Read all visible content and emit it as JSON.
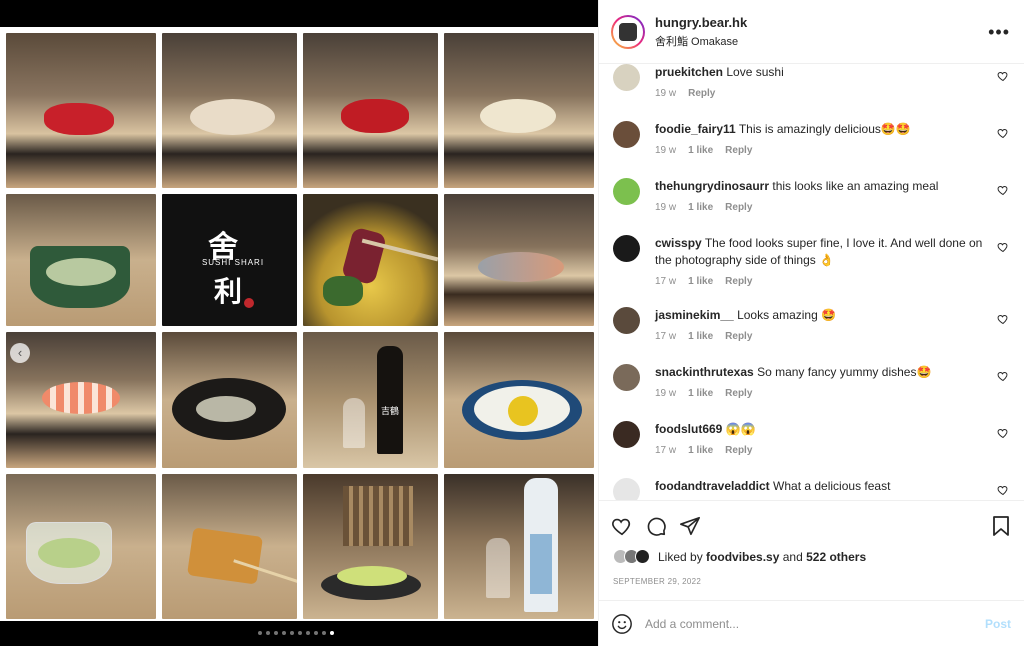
{
  "header": {
    "username": "hungry.bear.hk",
    "location": "舍利鮨 Omakase",
    "more_icon": "more-horizontal-icon"
  },
  "carousel": {
    "dot_count": 10,
    "active_dot": 9,
    "tile_logo_brand": "SUSHI SHARI",
    "bottle_label": "吉鶴"
  },
  "comments": [
    {
      "user": "pruekitchen",
      "text": "Love sushi",
      "age": "19 w",
      "likes": "",
      "reply": "Reply"
    },
    {
      "user": "foodie_fairy11",
      "text": "This is amazingly delicious🤩🤩",
      "age": "19 w",
      "likes": "1 like",
      "reply": "Reply"
    },
    {
      "user": "thehungrydinosaurr",
      "text": "this looks like an amazing meal",
      "age": "19 w",
      "likes": "1 like",
      "reply": "Reply"
    },
    {
      "user": "cwisspy",
      "text": "The food looks super fine, I love it. And well done on the photography side of things 👌",
      "age": "17 w",
      "likes": "1 like",
      "reply": "Reply"
    },
    {
      "user": "jasminekim__",
      "text": "Looks amazing 🤩",
      "age": "17 w",
      "likes": "1 like",
      "reply": "Reply"
    },
    {
      "user": "snackinthrutexas",
      "text": "So many fancy yummy dishes🤩",
      "age": "19 w",
      "likes": "1 like",
      "reply": "Reply"
    },
    {
      "user": "foodslut669",
      "text": "😱😱",
      "age": "17 w",
      "likes": "1 like",
      "reply": "Reply"
    },
    {
      "user": "foodandtraveladdict",
      "text": "What a delicious feast",
      "age": "",
      "likes": "",
      "reply": ""
    }
  ],
  "likes": {
    "prefix": "Liked by",
    "first_user": "foodvibes.sy",
    "conjunction": "and",
    "others": "522 others"
  },
  "date": "SEPTEMBER 29, 2022",
  "add_comment": {
    "placeholder": "Add a comment...",
    "post_label": "Post"
  },
  "colors": {
    "text": "#262626",
    "muted": "#8e8e8e",
    "post_disabled": "#b2dffc",
    "gradient_start": "#f9ce34",
    "gradient_mid": "#ee2a7b",
    "gradient_end": "#6228d7"
  }
}
